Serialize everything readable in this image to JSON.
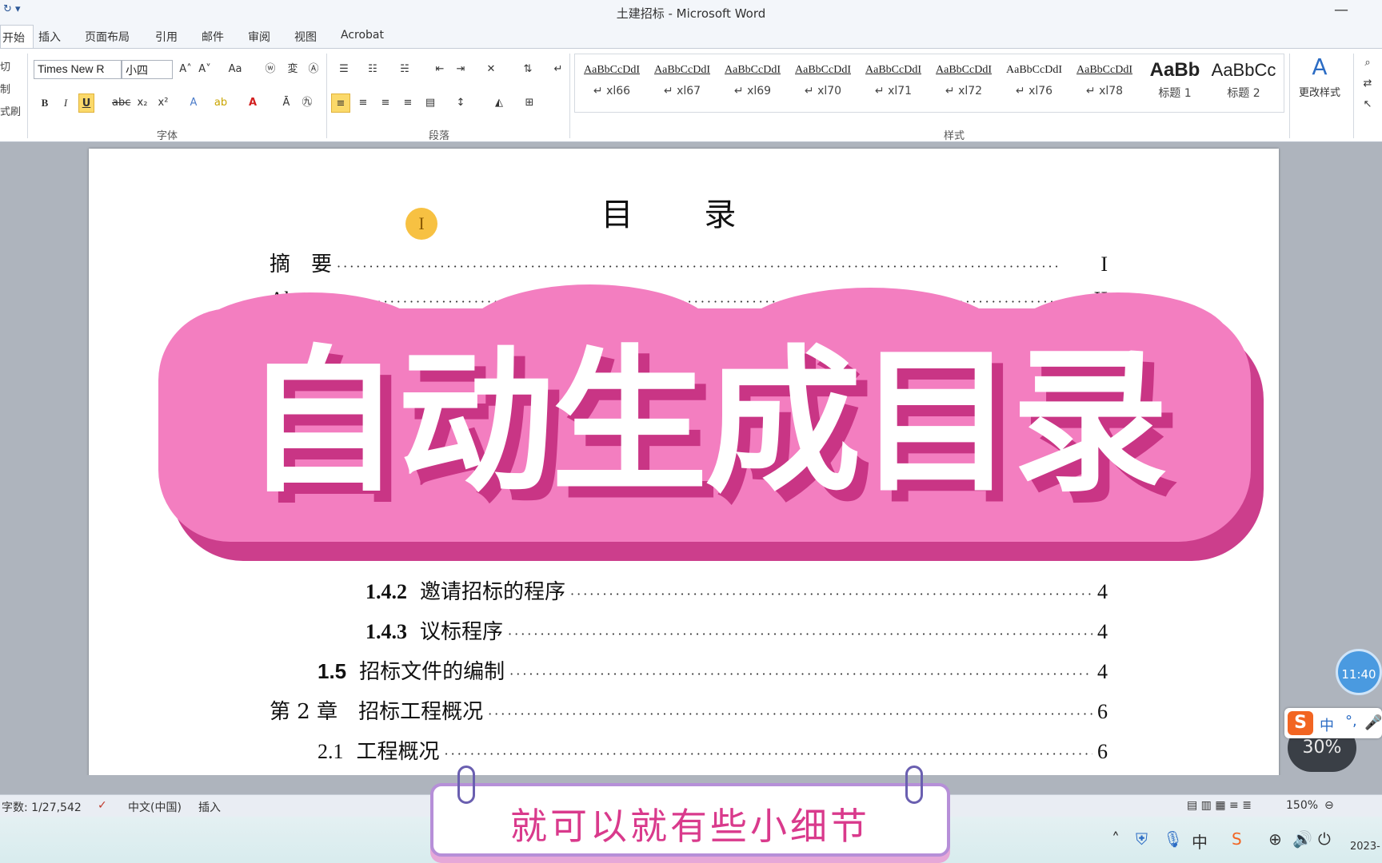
{
  "window": {
    "title": "土建招标 - Microsoft Word",
    "quick_access": "↻ ▾",
    "minimize_glyph": "—"
  },
  "tabs": [
    {
      "label": "开始"
    },
    {
      "label": "插入"
    },
    {
      "label": "页面布局"
    },
    {
      "label": "引用"
    },
    {
      "label": "邮件"
    },
    {
      "label": "审阅"
    },
    {
      "label": "视图"
    },
    {
      "label": "Acrobat"
    }
  ],
  "ribbon": {
    "clipboard_cut": [
      "切",
      "制",
      "式刷"
    ],
    "font": {
      "name": "Times New R",
      "size": "小四",
      "grow": "A˄",
      "shrink": "A˅",
      "case": "Aa",
      "bold": "B",
      "italic": "I",
      "underline": "U",
      "strike": "abc",
      "subscript": "x₂",
      "superscript": "x²",
      "group_label": "字体"
    },
    "paragraph_group_label": "段落",
    "styles_group_label": "样式",
    "change_styles_label": "更改样式",
    "styles": [
      {
        "preview": "AaBbCcDdI",
        "name": "↵ xl66"
      },
      {
        "preview": "AaBbCcDdI",
        "name": "↵ xl67"
      },
      {
        "preview": "AaBbCcDdI",
        "name": "↵ xl69"
      },
      {
        "preview": "AaBbCcDdI",
        "name": "↵ xl70"
      },
      {
        "preview": "AaBbCcDdI",
        "name": "↵ xl71"
      },
      {
        "preview": "AaBbCcDdI",
        "name": "↵ xl72"
      },
      {
        "preview": "AaBbCcDdI",
        "name": "↵ xl76"
      },
      {
        "preview": "AaBbCcDdI",
        "name": "↵ xl78"
      },
      {
        "preview": "AaBb",
        "name": "标题 1"
      },
      {
        "preview": "AaBbCc",
        "name": "标题 2"
      }
    ]
  },
  "document": {
    "toc_title": "目 录",
    "cursor_glyph": "I",
    "toc_entries": [
      {
        "num": "",
        "text": "摘　要",
        "page": "I"
      },
      {
        "num": "",
        "text": "Abstract",
        "page": "II"
      },
      {
        "num": "1.4.2",
        "text": "邀请招标的程序",
        "page": "4"
      },
      {
        "num": "1.4.3",
        "text": "议标程序",
        "page": "4"
      },
      {
        "num": "1.5",
        "text": "招标文件的编制",
        "page": "4"
      },
      {
        "num": "",
        "text": "第 2 章　招标工程概况",
        "page": "6"
      },
      {
        "num": "2.1",
        "text": "工程概况",
        "page": "6"
      }
    ]
  },
  "overlay": {
    "banner_text": "自动生成目录",
    "caption_text": "就可以就有些小细节"
  },
  "statusbar": {
    "word_count": "字数: 1/27,542",
    "language": "中文(中国)",
    "insert_mode": "插入",
    "zoom": "150%"
  },
  "widgets": {
    "clock": "11:40",
    "ime_s": "S",
    "ime_zh": "中",
    "ime_punct": "°,",
    "speed": "30%",
    "taskbar_date": "2023-"
  }
}
